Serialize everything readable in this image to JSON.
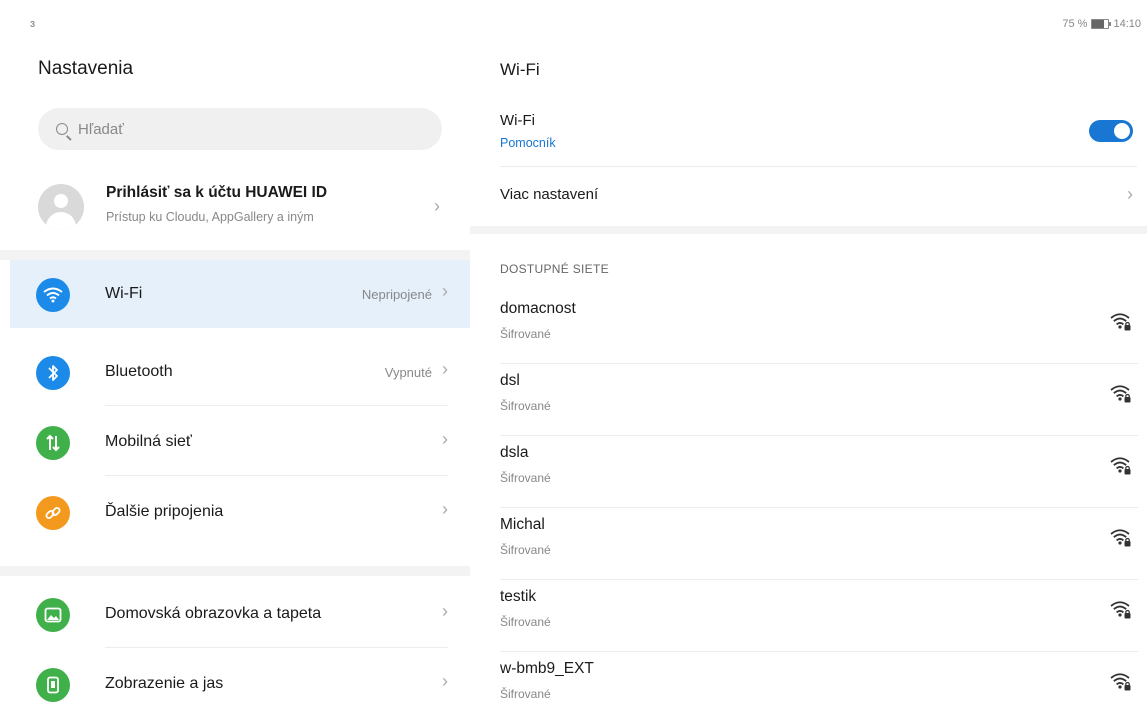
{
  "status_bar": {
    "left_glyph": "ɜ",
    "battery_text": "75 %",
    "time": "14:10"
  },
  "left_pane": {
    "title": "Nastavenia",
    "search_placeholder": "Hľadať",
    "account": {
      "title": "Prihlásiť sa k účtu HUAWEI ID",
      "subtitle": "Prístup ku Cloudu, AppGallery a iným"
    },
    "items": [
      {
        "label": "Wi-Fi",
        "value": "Nepripojené",
        "icon": "wifi-icon",
        "color": "#1b8ae8"
      },
      {
        "label": "Bluetooth",
        "value": "Vypnuté",
        "icon": "bluetooth-icon",
        "color": "#1b8ae8"
      },
      {
        "label": "Mobilná sieť",
        "value": "",
        "icon": "mobile-data-icon",
        "color": "#3fb04a"
      },
      {
        "label": "Ďalšie pripojenia",
        "value": "",
        "icon": "link-icon",
        "color": "#f39a1e"
      },
      {
        "label": "Domovská obrazovka a tapeta",
        "value": "",
        "icon": "image-icon",
        "color": "#3fb04a"
      },
      {
        "label": "Zobrazenie a jas",
        "value": "",
        "icon": "display-icon",
        "color": "#3fb04a"
      }
    ]
  },
  "right_pane": {
    "title": "Wi-Fi",
    "wifi_toggle": {
      "label": "Wi-Fi",
      "sub": "Pomocník",
      "on": true
    },
    "more_settings": "Viac nastavení",
    "section_header": "DOSTUPNÉ SIETE",
    "networks": [
      {
        "name": "domacnost",
        "security": "Šifrované"
      },
      {
        "name": "dsl",
        "security": "Šifrované"
      },
      {
        "name": "dsla",
        "security": "Šifrované"
      },
      {
        "name": "Michal",
        "security": "Šifrované"
      },
      {
        "name": "testik",
        "security": "Šifrované"
      },
      {
        "name": "w-bmb9_EXT",
        "security": "Šifrované"
      }
    ]
  },
  "colors": {
    "accent": "#1976d2",
    "selected_bg": "#e5f0fb"
  }
}
